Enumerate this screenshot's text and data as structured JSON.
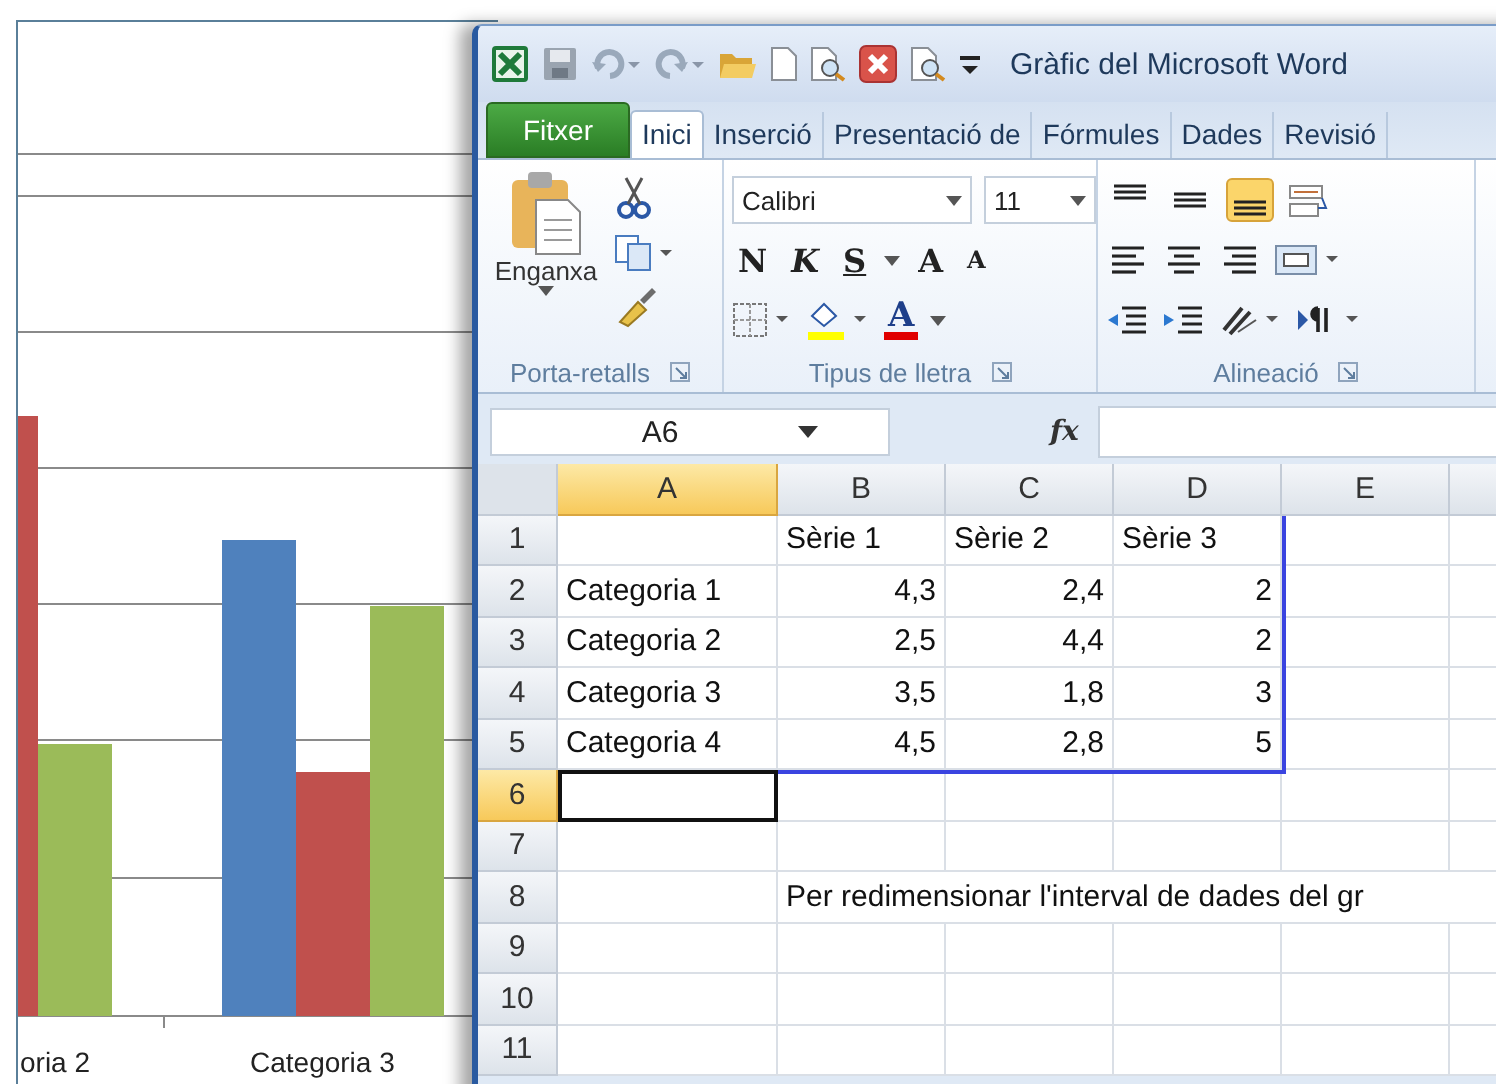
{
  "chart": {
    "category_labels": [
      "oria 2",
      "Categoria 3"
    ]
  },
  "window": {
    "title": "Gràfic del Microsoft Word"
  },
  "tabs": [
    {
      "label": "Fitxer",
      "kind": "file",
      "selected": false
    },
    {
      "label": "Inici",
      "kind": "tab",
      "selected": true
    },
    {
      "label": "Inserció",
      "kind": "tab",
      "selected": false
    },
    {
      "label": "Presentació de",
      "kind": "tab",
      "selected": false
    },
    {
      "label": "Fórmules",
      "kind": "tab",
      "selected": false
    },
    {
      "label": "Dades",
      "kind": "tab",
      "selected": false
    },
    {
      "label": "Revisió",
      "kind": "tab",
      "selected": false
    }
  ],
  "ribbon": {
    "clipboard": {
      "paste_label": "Enganxa",
      "group_label": "Porta-retalls"
    },
    "font": {
      "name": "Calibri",
      "size": "11",
      "style_buttons": [
        {
          "label": "N",
          "kind": "bold"
        },
        {
          "label": "K",
          "kind": "italic"
        },
        {
          "label": "S",
          "kind": "underline"
        }
      ],
      "size_buttons": [
        {
          "label": "A",
          "kind": "grow"
        },
        {
          "label": "A",
          "kind": "shrink"
        }
      ],
      "color_button": {
        "label": "A"
      },
      "group_label": "Tipus de lletra"
    },
    "alignment": {
      "vertical": [
        {
          "selected": false
        },
        {
          "selected": false
        },
        {
          "selected": true
        }
      ],
      "group_label": "Alineació"
    }
  },
  "formula_bar": {
    "name_box": "A6",
    "function_label": "fx"
  },
  "sheet": {
    "columns": [
      {
        "label": "A",
        "selected": true
      },
      {
        "label": "B",
        "selected": false
      },
      {
        "label": "C",
        "selected": false
      },
      {
        "label": "D",
        "selected": false
      },
      {
        "label": "E",
        "selected": false
      }
    ],
    "rows": [
      {
        "number": "1",
        "selected": false,
        "cells": [
          null,
          {
            "text": "Sèrie 1",
            "kind": "text"
          },
          {
            "text": "Sèrie 2",
            "kind": "text"
          },
          {
            "text": "Sèrie 3",
            "kind": "text"
          },
          null
        ]
      },
      {
        "number": "2",
        "selected": false,
        "cells": [
          {
            "text": "Categoria 1",
            "kind": "text"
          },
          {
            "text": "4,3",
            "kind": "number"
          },
          {
            "text": "2,4",
            "kind": "number"
          },
          {
            "text": "2",
            "kind": "number"
          },
          null
        ]
      },
      {
        "number": "3",
        "selected": false,
        "cells": [
          {
            "text": "Categoria 2",
            "kind": "text"
          },
          {
            "text": "2,5",
            "kind": "number"
          },
          {
            "text": "4,4",
            "kind": "number"
          },
          {
            "text": "2",
            "kind": "number"
          },
          null
        ]
      },
      {
        "number": "4",
        "selected": false,
        "cells": [
          {
            "text": "Categoria 3",
            "kind": "text"
          },
          {
            "text": "3,5",
            "kind": "number"
          },
          {
            "text": "1,8",
            "kind": "number"
          },
          {
            "text": "3",
            "kind": "number"
          },
          null
        ]
      },
      {
        "number": "5",
        "selected": false,
        "cells": [
          {
            "text": "Categoria 4",
            "kind": "text"
          },
          {
            "text": "4,5",
            "kind": "number"
          },
          {
            "text": "2,8",
            "kind": "number"
          },
          {
            "text": "5",
            "kind": "number"
          },
          null
        ]
      },
      {
        "number": "6",
        "selected": true,
        "cells": [
          null,
          null,
          null,
          null,
          null
        ]
      },
      {
        "number": "7",
        "selected": false,
        "cells": [
          null,
          null,
          null,
          null,
          null
        ]
      },
      {
        "number": "8",
        "selected": false,
        "cells": [
          null,
          {
            "text": "Per redimensionar l'interval de dades del gr",
            "kind": "overflow"
          },
          null,
          null,
          null
        ]
      },
      {
        "number": "9",
        "selected": false,
        "cells": [
          null,
          null,
          null,
          null,
          null
        ]
      },
      {
        "number": "10",
        "selected": false,
        "cells": [
          null,
          null,
          null,
          null,
          null
        ]
      },
      {
        "number": "11",
        "selected": false,
        "cells": [
          null,
          null,
          null,
          null,
          null
        ]
      }
    ]
  }
}
